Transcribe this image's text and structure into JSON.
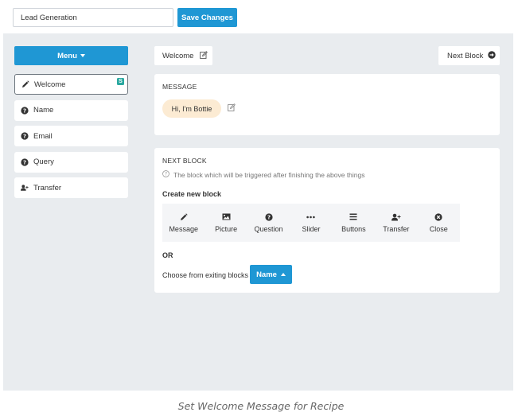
{
  "topbar": {
    "name_value": "Lead Generation",
    "save_label": "Save Changes"
  },
  "sidebar": {
    "menu_label": "Menu",
    "items": [
      {
        "label": "Welcome",
        "icon": "pencil-icon",
        "active": true,
        "badge": "S"
      },
      {
        "label": "Name",
        "icon": "question-circle-icon"
      },
      {
        "label": "Email",
        "icon": "question-circle-icon"
      },
      {
        "label": "Query",
        "icon": "question-circle-icon"
      },
      {
        "label": "Transfer",
        "icon": "user-plus-icon"
      }
    ]
  },
  "header": {
    "current_block": "Welcome",
    "next_label": "Next Block"
  },
  "message_card": {
    "title": "MESSAGE",
    "bubble_text": "Hi, I'm Bottie"
  },
  "next_card": {
    "title": "NEXT BLOCK",
    "hint": "The block which will be triggered after finishing the above things",
    "create_label": "Create new block",
    "options": [
      {
        "label": "Message",
        "icon": "pencil-icon"
      },
      {
        "label": "Picture",
        "icon": "image-icon"
      },
      {
        "label": "Question",
        "icon": "question-circle-icon"
      },
      {
        "label": "Slider",
        "icon": "ellipsis-icon"
      },
      {
        "label": "Buttons",
        "icon": "bars-icon"
      },
      {
        "label": "Transfer",
        "icon": "user-plus-icon"
      },
      {
        "label": "Close",
        "icon": "close-circle-icon"
      }
    ],
    "or_label": "OR",
    "choose_label": "Choose from exiting blocks",
    "choose_value": "Name"
  },
  "caption": "Set Welcome Message for Recipe",
  "colors": {
    "accent": "#1f97d4",
    "workspace": "#e9ecef",
    "bubble": "#fcebd3",
    "badge": "#2aa8a0"
  }
}
